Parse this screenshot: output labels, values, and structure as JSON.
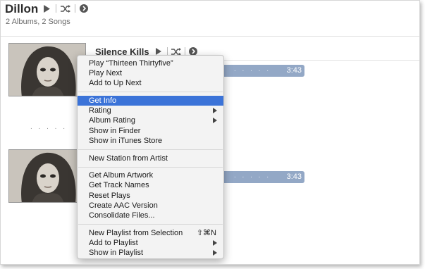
{
  "header": {
    "artist": "Dillon",
    "subtitle": "2 Albums, 2 Songs"
  },
  "album": {
    "name": "Silence Kills"
  },
  "tracks": [
    {
      "time": "3:43"
    },
    {
      "time": "3:43"
    }
  ],
  "dots": ". . . . .",
  "context_menu": {
    "items": [
      {
        "label": "Play “Thirteen Thirtyfive”"
      },
      {
        "label": "Play Next"
      },
      {
        "label": "Add to Up Next"
      },
      {
        "label": "Get Info",
        "highlighted": true
      },
      {
        "label": "Rating",
        "submenu": true
      },
      {
        "label": "Album Rating",
        "submenu": true
      },
      {
        "label": "Show in Finder"
      },
      {
        "label": "Show in iTunes Store"
      },
      {
        "label": "New Station from Artist"
      },
      {
        "label": "Get Album Artwork"
      },
      {
        "label": "Get Track Names"
      },
      {
        "label": "Reset Plays"
      },
      {
        "label": "Create AAC Version"
      },
      {
        "label": "Consolidate Files..."
      },
      {
        "label": "New Playlist from Selection",
        "shortcut": "⇧⌘N"
      },
      {
        "label": "Add to Playlist",
        "submenu": true
      },
      {
        "label": "Show in Playlist",
        "submenu": true
      }
    ]
  },
  "colors": {
    "highlight": "#3b73d8",
    "track_bar": "#93a8c6"
  },
  "icons": [
    "play-icon",
    "shuffle-icon",
    "more-options-icon",
    "submenu-arrow-icon"
  ]
}
